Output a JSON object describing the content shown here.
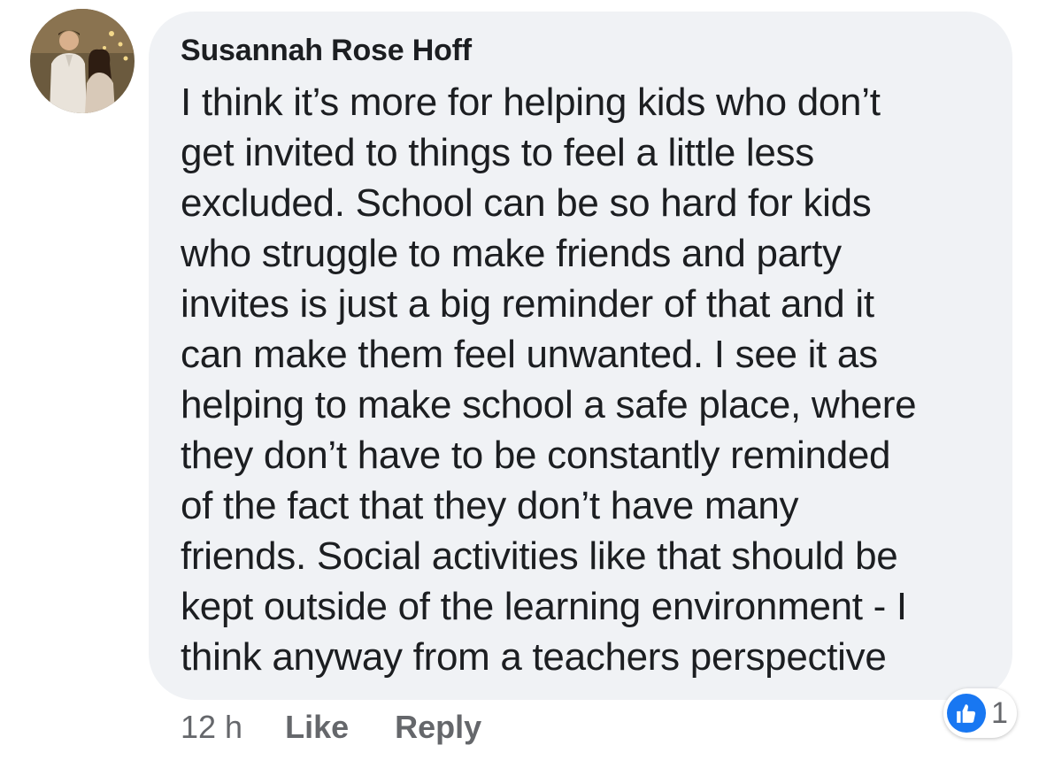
{
  "comment": {
    "author": "Susannah Rose Hoff",
    "text": "I think it’s more for helping kids who don’t\nget invited to things to feel a little less\nexcluded. School can be so hard for kids\nwho struggle to make friends and party\ninvites is just a big reminder of that and it\ncan make them feel unwanted. I see it as\nhelping to make school a safe place, where\nthey don’t have to be constantly reminded\nof the fact that they don’t have many\nfriends. Social activities like that should be\nkept outside of the learning environment - I\nthink anyway from a teachers perspective",
    "timestamp": "12 h",
    "like_label": "Like",
    "reply_label": "Reply",
    "reaction_count": "1",
    "reaction_icon": "thumbs-up-icon",
    "colors": {
      "bubble": "#f0f2f5",
      "text": "#1c1e21",
      "meta": "#65676b",
      "like_blue": "#1877f2"
    }
  }
}
